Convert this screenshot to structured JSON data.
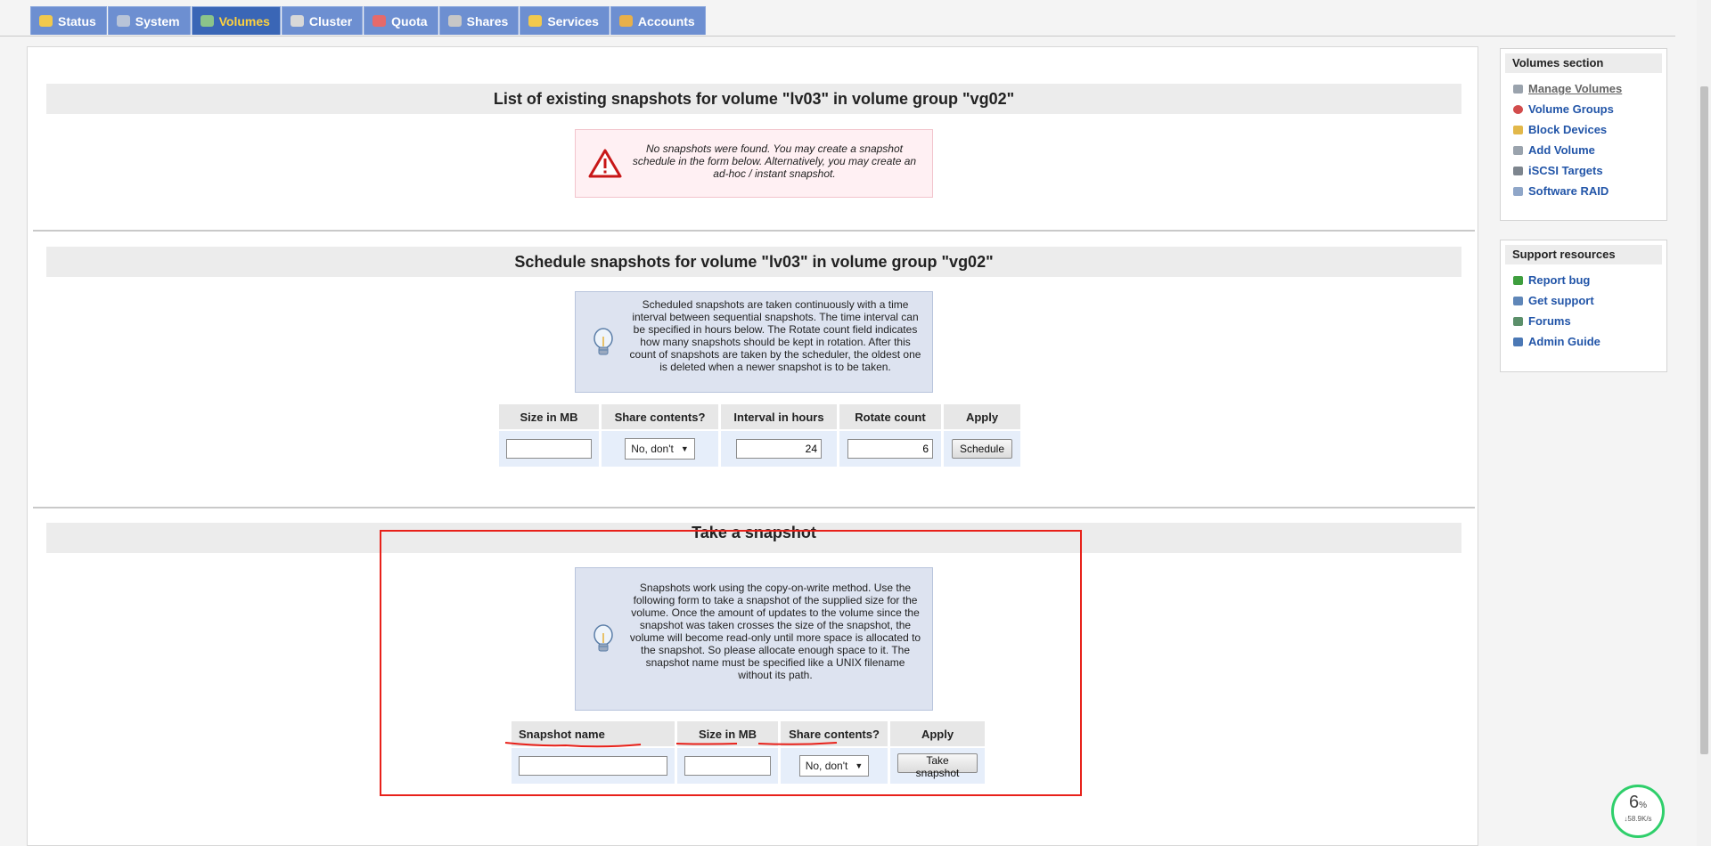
{
  "tabs": [
    {
      "label": "Status",
      "icon": "status-icon",
      "active": false
    },
    {
      "label": "System",
      "icon": "system-icon",
      "active": false
    },
    {
      "label": "Volumes",
      "icon": "volumes-icon",
      "active": true
    },
    {
      "label": "Cluster",
      "icon": "cluster-icon",
      "active": false
    },
    {
      "label": "Quota",
      "icon": "quota-icon",
      "active": false
    },
    {
      "label": "Shares",
      "icon": "shares-icon",
      "active": false
    },
    {
      "label": "Services",
      "icon": "services-icon",
      "active": false
    },
    {
      "label": "Accounts",
      "icon": "accounts-icon",
      "active": false
    }
  ],
  "existing": {
    "title": "List of existing snapshots for volume \"lv03\" in volume group \"vg02\"",
    "message": "No snapshots were found. You may create a snapshot schedule in the form below. Alternatively, you may create an ad-hoc / instant snapshot."
  },
  "schedule": {
    "title": "Schedule snapshots for volume \"lv03\" in volume group \"vg02\"",
    "info": "Scheduled snapshots are taken continuously with a time interval between sequential snapshots. The time interval can be specified in hours below. The Rotate count field indicates how many snapshots should be kept in rotation. After this count of snapshots are taken by the scheduler, the oldest one is deleted when a newer snapshot is to be taken.",
    "headers": {
      "size": "Size in MB",
      "share": "Share contents?",
      "interval": "Interval in hours",
      "rotate": "Rotate count",
      "apply": "Apply"
    },
    "size_value": "",
    "share_value": "No, don't",
    "interval_value": "24",
    "rotate_value": "6",
    "button": "Schedule"
  },
  "take": {
    "title": "Take a snapshot",
    "info": "Snapshots work using the copy-on-write method. Use the following form to take a snapshot of the supplied size for the volume. Once the amount of updates to the volume since the snapshot was taken crosses the size of the snapshot, the volume will become read-only until more space is allocated to the snapshot. So please allocate enough space to it. The snapshot name must be specified like a UNIX filename without its path.",
    "headers": {
      "name": "Snapshot name",
      "size": "Size in MB",
      "share": "Share contents?",
      "apply": "Apply"
    },
    "name_value": "",
    "size_value": "",
    "share_value": "No, don't",
    "button": "Take snapshot"
  },
  "sidebar": {
    "volumes_title": "Volumes section",
    "volumes_items": [
      {
        "label": "Manage Volumes",
        "icon": "manage-volumes-icon",
        "current": true
      },
      {
        "label": "Volume Groups",
        "icon": "volume-groups-icon",
        "current": false
      },
      {
        "label": "Block Devices",
        "icon": "block-devices-icon",
        "current": false
      },
      {
        "label": "Add Volume",
        "icon": "add-volume-icon",
        "current": false
      },
      {
        "label": "iSCSI Targets",
        "icon": "iscsi-targets-icon",
        "current": false
      },
      {
        "label": "Software RAID",
        "icon": "software-raid-icon",
        "current": false
      }
    ],
    "support_title": "Support resources",
    "support_items": [
      {
        "label": "Report bug",
        "icon": "report-bug-icon"
      },
      {
        "label": "Get support",
        "icon": "get-support-icon"
      },
      {
        "label": "Forums",
        "icon": "forums-icon"
      },
      {
        "label": "Admin Guide",
        "icon": "admin-guide-icon"
      }
    ]
  },
  "speed_widget": {
    "percent": "6",
    "percent_unit": "%",
    "rate": "↓58.9K/s"
  },
  "colors": {
    "tab": "#6d8fd1",
    "tab_active": "#3a66b6",
    "tab_active_text": "#ffd23d",
    "link": "#2255a8",
    "annotation": "#e8211a"
  }
}
